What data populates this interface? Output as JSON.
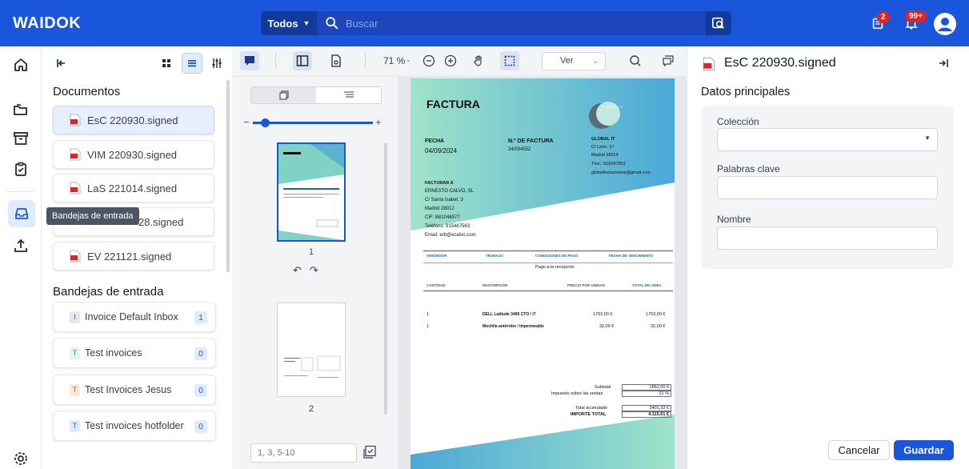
{
  "header": {
    "logo": "WAIDOK",
    "search_scope": "Todos",
    "search_placeholder": "Buscar",
    "tasks_badge": "2",
    "notifications_badge": "99+"
  },
  "nav": {
    "tooltip": "Bandejas de entrada"
  },
  "documents": {
    "title": "Documentos",
    "items": [
      {
        "label": "EsC 220930.signed"
      },
      {
        "label": "VIM 220930.signed"
      },
      {
        "label": "LaS 221014.signed"
      },
      {
        "label": "28.signed"
      },
      {
        "label": "EV 221121.signed"
      }
    ]
  },
  "inboxes": {
    "title": "Bandejas de entrada",
    "items": [
      {
        "letter": "I",
        "label": "Invoice Default Inbox",
        "count": "1",
        "color": "#e5e7eb"
      },
      {
        "letter": "T",
        "label": "Test invoices",
        "count": "0",
        "color": "#dcfce7"
      },
      {
        "letter": "T",
        "label": "Test Invoices Jesus",
        "count": "0",
        "color": "#fde8d7"
      },
      {
        "letter": "T",
        "label": "Test invoices hotfolder",
        "count": "0",
        "color": "#dbeafe"
      }
    ]
  },
  "viewer": {
    "zoom": "71 %",
    "view_select": "Ver",
    "page_range_placeholder": "1, 3, 5-10",
    "thumbs": [
      {
        "page": "1"
      },
      {
        "page": "2"
      }
    ]
  },
  "invoice": {
    "title": "FACTURA",
    "company": "GLOBAL IT",
    "fecha_label": "FECHA",
    "fecha": "04/09/2024",
    "num_label": "N.º DE FACTURA",
    "num": "24/034552",
    "company_lines": [
      "GLOBAL IT",
      "C/ León, 17",
      "Madrid 28014",
      "Tlno.: 916547891",
      "globalitsoluciones@gmail.com"
    ],
    "bill_to_label": "FACTURAR A",
    "bill_to_lines": [
      "ERNESTO CALVO, SL",
      "C/ Santa Isabel, 3",
      "Madrid 28012",
      "CIF: B81048977",
      "Teléfono: 915467563",
      "Email: erb@ecalvo.com"
    ],
    "terms_headers": [
      "VENDEDOR",
      "TRABAJO",
      "CONDICIONES DE PAGO",
      "FECHA DE VENCIMIENTO"
    ],
    "terms_value": "Pago a la recepción",
    "items_headers": [
      "CANTIDAD",
      "DESCRIPCIÓN",
      "PRECIO POR UNIDAD",
      "TOTAL DE LÍNEA"
    ],
    "lines": [
      {
        "qty": "1",
        "desc": "DELL Latitude 3400 CTO / i7",
        "price": "1753,00 €",
        "total": "1753,00 €"
      },
      {
        "qty": "1",
        "desc": "Mochila antirrobo / Impermeable",
        "price": "32,00 €",
        "total": "32,00 €"
      }
    ],
    "subtotal_label": "Subtotal",
    "subtotal": "1852,00 €",
    "tax_label": "Impuesto sobre las ventas",
    "tax": "21 %",
    "acc_label": "Total acumulado",
    "acc": "3401,33 €",
    "total_label": "IMPORTE TOTAL",
    "total": "4.115,61 €"
  },
  "details": {
    "title": "EsC 220930.signed",
    "section": "Datos principales",
    "coleccion_label": "Colección",
    "palabras_label": "Palabras clave",
    "nombre_label": "Nombre",
    "cancel": "Cancelar",
    "save": "Guardar"
  }
}
